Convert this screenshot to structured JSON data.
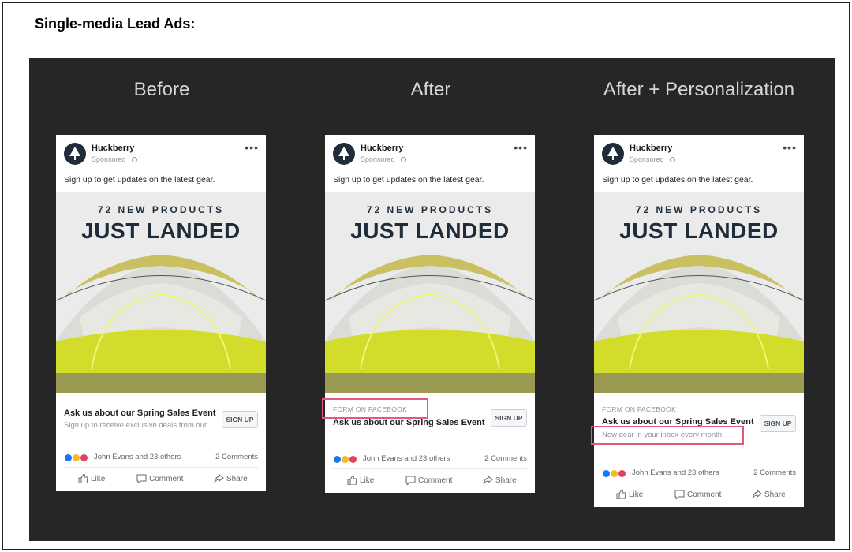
{
  "heading": "Single-media Lead Ads:",
  "columns": [
    {
      "title": "Before",
      "brand": "Huckberry",
      "sponsored": "Sponsored ·",
      "caption": "Sign up to get updates on the latest gear.",
      "kicker": "72 NEW PRODUCTS",
      "headline": "JUST LANDED",
      "form_label": "",
      "cta_title": "Ask us about our Spring Sales Event",
      "cta_sub": "Sign up to receive exclusive deals from our...",
      "signup": "SIGN UP",
      "reactions_names": "John Evans and 23 others",
      "comments": "2 Comments",
      "like": "Like",
      "comment": "Comment",
      "share": "Share"
    },
    {
      "title": "After",
      "brand": "Huckberry",
      "sponsored": "Sponsored ·",
      "caption": "Sign up to get updates on the latest gear.",
      "kicker": "72 NEW PRODUCTS",
      "headline": "JUST LANDED",
      "form_label": "FORM ON FACEBOOK",
      "cta_title": "Ask us about our Spring Sales Event",
      "cta_sub": "",
      "signup": "SIGN UP",
      "reactions_names": "John Evans and 23 others",
      "comments": "2 Comments",
      "like": "Like",
      "comment": "Comment",
      "share": "Share"
    },
    {
      "title": "After + Personalization",
      "brand": "Huckberry",
      "sponsored": "Sponsored ·",
      "caption": "Sign up to get updates on the latest gear.",
      "kicker": "72 NEW PRODUCTS",
      "headline": "JUST LANDED",
      "form_label": "FORM ON FACEBOOK",
      "cta_title": "Ask us about our Spring Sales Event",
      "cta_sub": "New gear in your inbox every month",
      "signup": "SIGN UP",
      "reactions_names": "John Evans and 23 others",
      "comments": "2 Comments",
      "like": "Like",
      "comment": "Comment",
      "share": "Share"
    }
  ],
  "colors": {
    "stage": "#262626",
    "highlight": "#e05a7a",
    "tent_yellow": "#d4e02a",
    "brand_navy": "#1f2c3a"
  }
}
